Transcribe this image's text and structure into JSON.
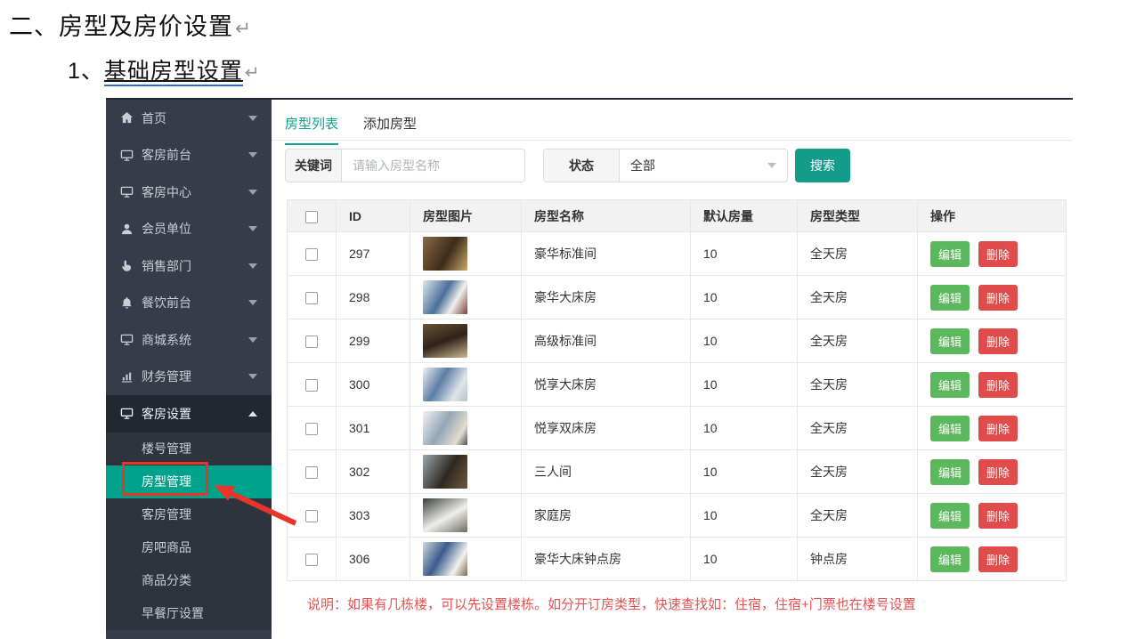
{
  "document": {
    "heading1": "二、房型及房价设置",
    "heading2_prefix": "1、",
    "heading2_text": "基础房型设置",
    "return_mark": "↵",
    "note": "说明：如果有几栋楼，可以先设置楼栋。如分开订房类型，快速查找如：住宿，住宿+门票也在楼号设置"
  },
  "sidebar": {
    "items": [
      {
        "label": "首页",
        "icon": "home-icon"
      },
      {
        "label": "客房前台",
        "icon": "desktop-icon"
      },
      {
        "label": "客房中心",
        "icon": "desktop-icon"
      },
      {
        "label": "会员单位",
        "icon": "user-icon"
      },
      {
        "label": "销售部门",
        "icon": "hand-pointer-icon"
      },
      {
        "label": "餐饮前台",
        "icon": "bell-icon"
      },
      {
        "label": "商城系统",
        "icon": "desktop-icon"
      },
      {
        "label": "财务管理",
        "icon": "bar-chart-icon"
      },
      {
        "label": "客房设置",
        "icon": "desktop-icon",
        "expanded": true
      }
    ],
    "subitems": [
      {
        "label": "楼号管理"
      },
      {
        "label": "房型管理",
        "active": true
      },
      {
        "label": "客房管理"
      },
      {
        "label": "房吧商品"
      },
      {
        "label": "商品分类"
      },
      {
        "label": "早餐厅设置"
      }
    ]
  },
  "tabs": [
    {
      "label": "房型列表",
      "active": true
    },
    {
      "label": "添加房型",
      "active": false
    }
  ],
  "search": {
    "keyword_label": "关键词",
    "keyword_placeholder": "请输入房型名称",
    "status_label": "状态",
    "status_value": "全部",
    "button_label": "搜索"
  },
  "table": {
    "headers": {
      "id": "ID",
      "image": "房型图片",
      "name": "房型名称",
      "count": "默认房量",
      "type": "房型类型",
      "ops": "操作"
    },
    "edit_label": "编辑",
    "delete_label": "删除",
    "rows": [
      {
        "id": "297",
        "name": "豪华标准间",
        "count": "10",
        "type": "全天房"
      },
      {
        "id": "298",
        "name": "豪华大床房",
        "count": "10",
        "type": "全天房"
      },
      {
        "id": "299",
        "name": "高级标准间",
        "count": "10",
        "type": "全天房"
      },
      {
        "id": "300",
        "name": "悦享大床房",
        "count": "10",
        "type": "全天房"
      },
      {
        "id": "301",
        "name": "悦享双床房",
        "count": "10",
        "type": "全天房"
      },
      {
        "id": "302",
        "name": "三人间",
        "count": "10",
        "type": "全天房"
      },
      {
        "id": "303",
        "name": "家庭房",
        "count": "10",
        "type": "全天房"
      },
      {
        "id": "306",
        "name": "豪华大床钟点房",
        "count": "10",
        "type": "钟点房"
      }
    ]
  },
  "colors": {
    "accent_teal": "#12a08d",
    "sidebar_active": "#00a28b",
    "edit_green": "#5cb85c",
    "delete_red": "#e04b4c",
    "annotation_red": "#e8352c",
    "note_red": "#e85252"
  }
}
